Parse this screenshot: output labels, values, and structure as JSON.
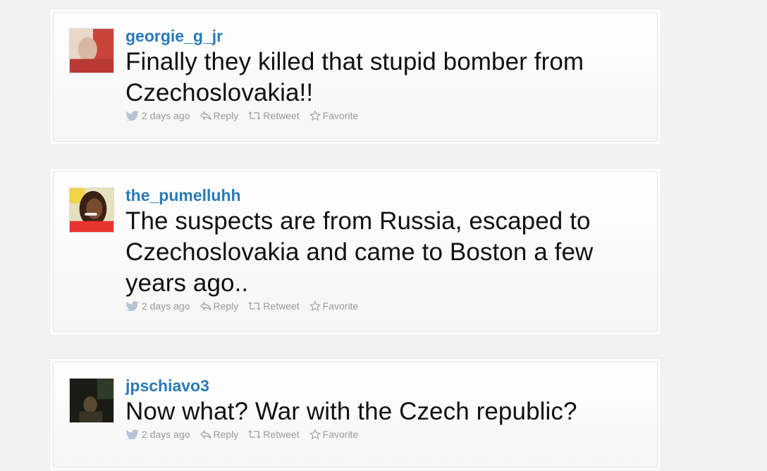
{
  "tweets": [
    {
      "username": "georgie_g_jr",
      "text": "Finally they killed that stupid bomber from Czechoslovakia!!",
      "time": "2 days ago",
      "reply": "Reply",
      "retweet": "Retweet",
      "favorite": "Favorite",
      "avatar_colors": [
        "#c9443b",
        "#e9d7c8"
      ]
    },
    {
      "username": "the_pumelluhh",
      "text": "The suspects are from Russia, escaped to Czechoslovakia and came to Boston a few years ago..",
      "time": "2 days ago",
      "reply": "Reply",
      "retweet": "Retweet",
      "favorite": "Favorite",
      "avatar_colors": [
        "#e8342f",
        "#3a2116"
      ]
    },
    {
      "username": "jpschiavo3",
      "text": "Now what? War with the Czech republic?",
      "time": "2 days ago",
      "reply": "Reply",
      "retweet": "Retweet",
      "favorite": "Favorite",
      "avatar_colors": [
        "#1b1b16",
        "#5a4a32"
      ]
    }
  ],
  "icons": {
    "bird": "bird-icon",
    "reply": "reply-icon",
    "retweet": "retweet-icon",
    "favorite": "star-icon"
  },
  "colors": {
    "username": "#2a7ab8",
    "meta": "#9a9a9a",
    "page_bg": "#f2f2f2"
  }
}
